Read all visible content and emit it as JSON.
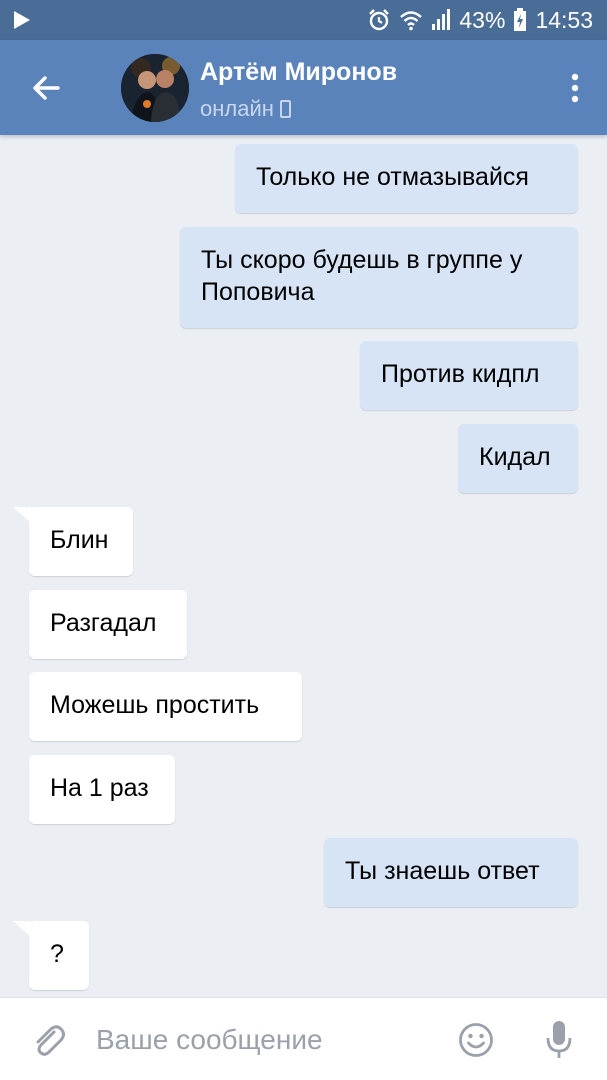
{
  "status_bar": {
    "icons": [
      "play-icon",
      "alarm-icon",
      "wifi-icon",
      "signal-icon",
      "battery-icon"
    ],
    "battery": "43%",
    "time": "14:53"
  },
  "header": {
    "contact_name": "Артём Миронов",
    "status": "онлайн",
    "icons": [
      "back-arrow-icon",
      "mobile-phone-icon",
      "more-vertical-icon"
    ]
  },
  "messages": [
    {
      "direction": "out",
      "text": "Только не отмазывайся"
    },
    {
      "direction": "out",
      "text": "Ты скоро будешь в группе у Поповича"
    },
    {
      "direction": "out",
      "text": "Против кидпл"
    },
    {
      "direction": "out",
      "text": "Кидал"
    },
    {
      "direction": "in",
      "text": "Блин"
    },
    {
      "direction": "in",
      "text": "Разгадал"
    },
    {
      "direction": "in",
      "text": "Можешь простить"
    },
    {
      "direction": "in",
      "text": "На 1 раз"
    },
    {
      "direction": "out",
      "text": "Ты знаешь ответ"
    },
    {
      "direction": "in",
      "text": "?"
    }
  ],
  "composer": {
    "placeholder": "Ваше сообщение",
    "value": "",
    "icons": [
      "paperclip-icon",
      "smiley-icon",
      "microphone-icon"
    ]
  },
  "colors": {
    "status_bar": "#4a6d98",
    "header": "#5b83bb",
    "chat_background": "#ebeff4",
    "outgoing_bubble": "#d6e4f5",
    "incoming_bubble": "#ffffff"
  }
}
